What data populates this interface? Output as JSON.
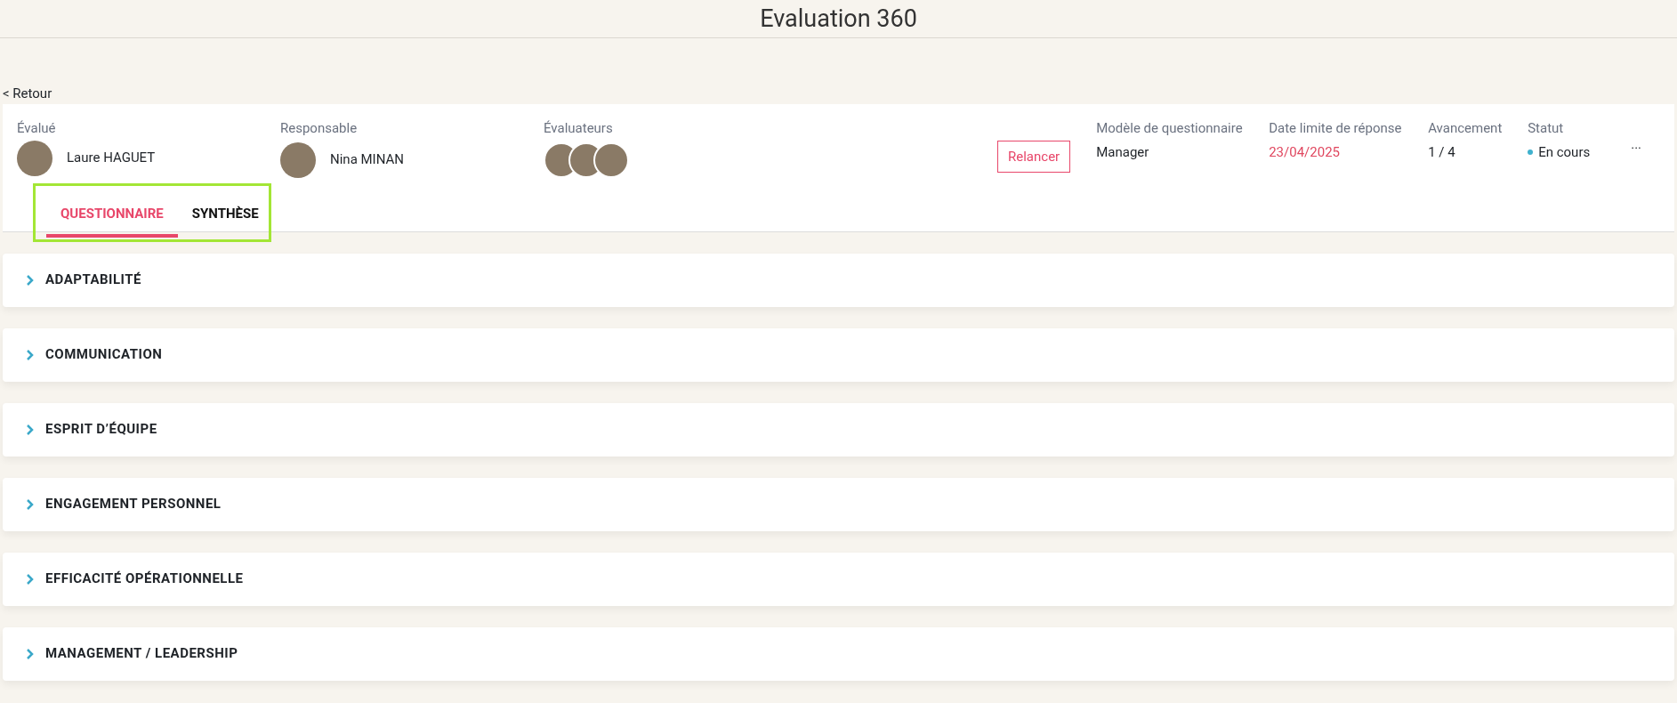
{
  "page_title": "Evaluation 360",
  "back_link": "< Retour",
  "header": {
    "evaluated": {
      "label": "Évalué",
      "name": "Laure HAGUET"
    },
    "manager": {
      "label": "Responsable",
      "name": "Nina MINAN"
    },
    "evaluators": {
      "label": "Évaluateurs",
      "avatars": [
        {
          "kind": "photo"
        },
        {
          "kind": "photo"
        },
        {
          "kind": "photo"
        }
      ]
    },
    "remind_button": "Relancer",
    "fields": [
      {
        "label": "Modèle de questionnaire",
        "value": "Manager",
        "kind": "plain"
      },
      {
        "label": "Date limite de réponse",
        "value": "23/04/2025",
        "kind": "date"
      },
      {
        "label": "Avancement",
        "value": "1 / 4",
        "kind": "plain"
      },
      {
        "label": "Statut",
        "value": "En cours",
        "kind": "status",
        "color": "#3fb1ce"
      }
    ],
    "more_menu": "..."
  },
  "tabs": [
    {
      "label": "QUESTIONNAIRE",
      "selected": true
    },
    {
      "label": "SYNTHÈSE",
      "selected": false
    }
  ],
  "sections": [
    {
      "title": "ADAPTABILITÉ",
      "expanded": false
    },
    {
      "title": "COMMUNICATION",
      "expanded": false
    },
    {
      "title": "ESPRIT D’ÉQUIPE",
      "expanded": false
    },
    {
      "title": "ENGAGEMENT PERSONNEL",
      "expanded": false
    },
    {
      "title": "EFFICACITÉ OPÉRATIONNELLE",
      "expanded": false
    },
    {
      "title": "MANAGEMENT / LEADERSHIP",
      "expanded": false
    }
  ]
}
